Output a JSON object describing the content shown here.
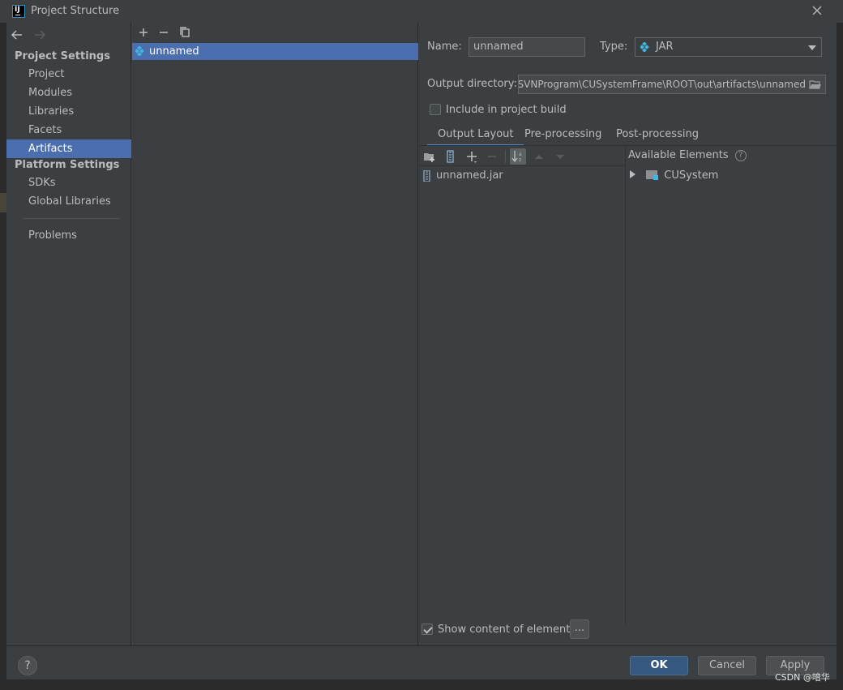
{
  "window": {
    "title": "Project Structure",
    "app_icon_text": "IJ",
    "close_icon": "close-icon"
  },
  "nav": {
    "back_icon": "arrow-left-icon",
    "forward_icon": "arrow-right-icon"
  },
  "sidebar": {
    "project_settings_header": "Project Settings",
    "project_settings_items": [
      {
        "label": "Project",
        "selected": false
      },
      {
        "label": "Modules",
        "selected": false
      },
      {
        "label": "Libraries",
        "selected": false
      },
      {
        "label": "Facets",
        "selected": false
      },
      {
        "label": "Artifacts",
        "selected": true
      }
    ],
    "platform_settings_header": "Platform Settings",
    "platform_settings_items": [
      {
        "label": "SDKs"
      },
      {
        "label": "Global Libraries"
      }
    ],
    "problems_label": "Problems"
  },
  "artifacts_list": {
    "toolbar": [
      "add-icon",
      "remove-icon",
      "copy-icon"
    ],
    "items": [
      {
        "label": "unnamed",
        "selected": true
      }
    ]
  },
  "details": {
    "name_label": "Name:",
    "name_value": "unnamed",
    "type_label": "Type:",
    "type_value": "JAR",
    "output_dir_label": "Output directory:",
    "output_dir_value": "SVNProgram\\CUSystemFrame\\ROOT\\out\\artifacts\\unnamed",
    "include_label": "Include in project build",
    "include_checked": false,
    "tabs": [
      {
        "label": "Output Layout",
        "active": true
      },
      {
        "label": "Pre-processing",
        "active": false
      },
      {
        "label": "Post-processing",
        "active": false
      }
    ],
    "layout_tree": [
      {
        "label": "unnamed.jar"
      }
    ],
    "available_elements_label": "Available Elements",
    "available_tree": [
      {
        "label": "CUSystem"
      }
    ],
    "show_content_label": "Show content of elements",
    "show_content_checked": true,
    "ellipsis_button": "..."
  },
  "footer": {
    "help_label": "?",
    "ok_label": "OK",
    "cancel_label": "Cancel",
    "apply_label": "Apply"
  },
  "watermark": "CSDN @喑华",
  "colors": {
    "background": "#3c3f41",
    "selection": "#4b6eaf",
    "default_button": "#365880",
    "tab_underline": "#4a88c7"
  }
}
